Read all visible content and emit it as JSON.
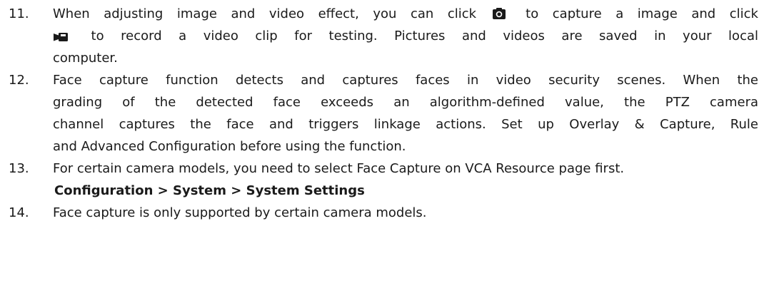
{
  "items": [
    {
      "number": "11.",
      "line1_before": "When adjusting image and video effect, you can click",
      "line1_after": "to capture a image and click",
      "line2_after": "to record a video clip for testing. Pictures and videos are saved in your local",
      "line3": "computer."
    },
    {
      "number": "12.",
      "line1": "Face capture function detects and captures faces in video security scenes. When the",
      "line2": "grading of the detected face exceeds an algorithm-defined value, the PTZ camera",
      "line3": "channel captures the face and triggers linkage actions. Set up Overlay & Capture, Rule",
      "line4": "and Advanced Configuration before using the function."
    },
    {
      "number": "13.",
      "line1": "For certain camera models, you need to select Face Capture on VCA Resource page first.",
      "path": "Configuration > System > System Settings"
    },
    {
      "number": "14.",
      "line1": "Face capture is only supported by certain camera models."
    }
  ],
  "icons": {
    "capture": "camera-icon",
    "record": "video-camera-icon",
    "color": "#1a1a1a"
  }
}
